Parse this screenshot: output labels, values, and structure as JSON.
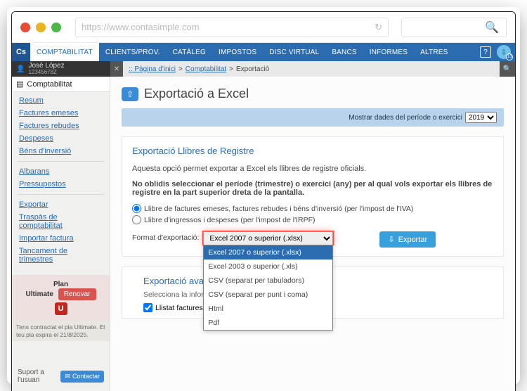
{
  "browser": {
    "url": "https://www.contasimple.com"
  },
  "nav": {
    "logo": "Cs",
    "items": [
      "COMPTABILITAT",
      "CLIENTS/PROV.",
      "CATÀLEG",
      "IMPOSTOS",
      "DISC VIRTUAL",
      "BANCS",
      "INFORMES",
      "ALTRES"
    ],
    "help": "?",
    "avatar_badge": "13"
  },
  "user": {
    "name": "José López",
    "id": "12345678Z"
  },
  "breadcrumb": {
    "root": ":: Pàgina d'inici",
    "mid": "Comptabilitat",
    "leaf": "Exportació"
  },
  "sidebar": {
    "title": "Comptabilitat",
    "group1": [
      "Resum",
      "Factures emeses",
      "Factures rebudes",
      "Despeses",
      "Béns d'inversió"
    ],
    "group2": [
      "Albarans",
      "Pressupostos"
    ],
    "group3": [
      "Exportar",
      "Traspàs de comptabilitat",
      "Importar factura",
      "Tancament de trimestres"
    ]
  },
  "plan": {
    "label": "Plan",
    "name": "Ultimate",
    "badge": "U",
    "renew": "Renovar",
    "note": "Tens contractat el pla Ultimate. El teu pla expira el 21/8/2025."
  },
  "support": {
    "label": "Suport a l'usuari",
    "button": "Contactar"
  },
  "page": {
    "title": "Exportació a Excel",
    "period_label": "Mostrar dades del període o exercici",
    "period_value": "2019"
  },
  "section1": {
    "title": "Exportació Llibres de Registre",
    "intro": "Aquesta opció permet exportar a Excel els llibres de registre oficials.",
    "bold": "No oblidis seleccionar el període (trimestre) o exercici (any) per al qual vols exportar els llibres de registre en la part superior dreta de la pantalla.",
    "radio1": "Llibre de factures emeses, factures rebudes i béns d'inversió (per l'impost de l'IVA)",
    "radio2": "Llibre d'ingressos i despeses (per l'impost de l'IRPF)",
    "format_label": "Format d'exportació:",
    "format_selected": "Excel 2007 o superior (.xlsx)",
    "format_options": [
      "Excel 2007 o superior (.xlsx)",
      "Excel 2003 o superior (.xls)",
      "CSV (separat per tabuladors)",
      "CSV (separat per punt i coma)",
      "Html",
      "Pdf"
    ],
    "export_button": "Exportar"
  },
  "section2": {
    "title": "Exportació avançada",
    "sub": "Selecciona la informació a exportar:",
    "chk1": "Llistat factures (emeses, rebudes i béns de inversió)."
  }
}
